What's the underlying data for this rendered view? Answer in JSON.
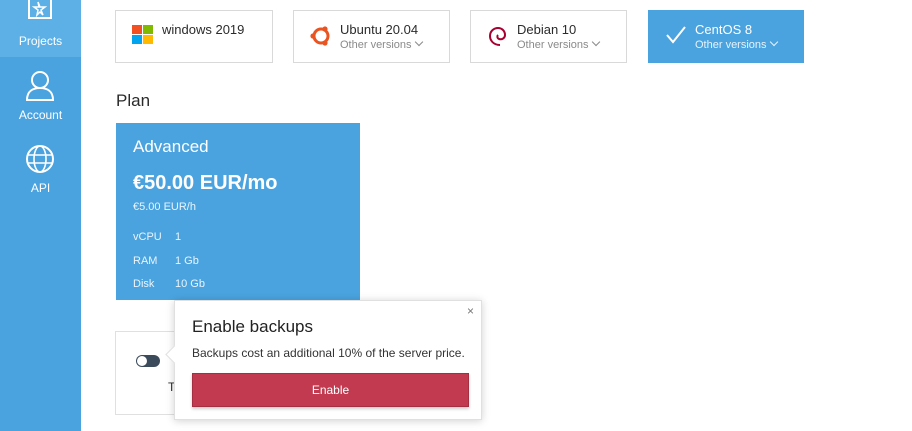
{
  "sidebar": {
    "items": [
      {
        "label": "Projects",
        "icon": "projects-icon"
      },
      {
        "label": "Account",
        "icon": "account-icon"
      },
      {
        "label": "API",
        "icon": "api-icon"
      }
    ]
  },
  "os_options": [
    {
      "name": "windows 2019",
      "versions": "",
      "icon": "windows-logo-icon",
      "selected": false
    },
    {
      "name": "Ubuntu 20.04",
      "versions": "Other versions",
      "icon": "ubuntu-logo-icon",
      "selected": false
    },
    {
      "name": "Debian 10",
      "versions": "Other versions",
      "icon": "debian-logo-icon",
      "selected": false
    },
    {
      "name": "CentOS 8",
      "versions": "Other versions",
      "icon": "check-icon",
      "selected": true
    }
  ],
  "plan": {
    "section_title": "Plan",
    "name": "Advanced",
    "price": "€50.00 EUR/mo",
    "hourly": "€5.00 EUR/h",
    "specs": [
      {
        "key": "vCPU",
        "value": "1"
      },
      {
        "key": "RAM",
        "value": "1 Gb"
      },
      {
        "key": "Disk",
        "value": "10 Gb"
      }
    ]
  },
  "backups": {
    "partial_label": "T",
    "enabled": false
  },
  "popover": {
    "close": "×",
    "title": "Enable backups",
    "description": "Backups cost an additional 10% of the server price.",
    "button": "Enable"
  },
  "colors": {
    "accent": "#4aa3df",
    "danger": "#c23a4f",
    "sidebar": "#4aa3df"
  }
}
